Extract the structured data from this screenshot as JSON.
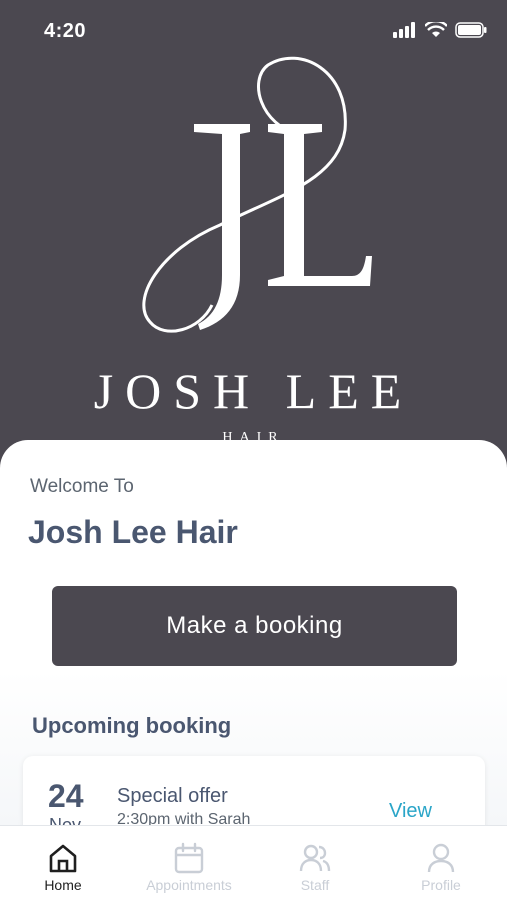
{
  "status_bar": {
    "time": "4:20"
  },
  "brand": {
    "monogram": "JL",
    "name": "JOSH LEE",
    "sub": "HAIR"
  },
  "welcome": {
    "label": "Welcome To",
    "salon_name": "Josh Lee Hair"
  },
  "cta": {
    "label": "Make a booking"
  },
  "upcoming": {
    "title": "Upcoming booking",
    "booking": {
      "day": "24",
      "month": "Nov",
      "title": "Special offer",
      "detail": "2:30pm with Sarah",
      "action": "View"
    }
  },
  "tabs": [
    {
      "label": "Home",
      "icon": "home-icon",
      "active": true
    },
    {
      "label": "Appointments",
      "icon": "calendar-icon",
      "active": false
    },
    {
      "label": "Staff",
      "icon": "users-icon",
      "active": false
    },
    {
      "label": "Profile",
      "icon": "person-icon",
      "active": false
    }
  ],
  "colors": {
    "hero_bg": "#4b4850",
    "heading": "#4a5770",
    "link": "#2aa5c8",
    "inactive_tab": "#c9ced6"
  }
}
